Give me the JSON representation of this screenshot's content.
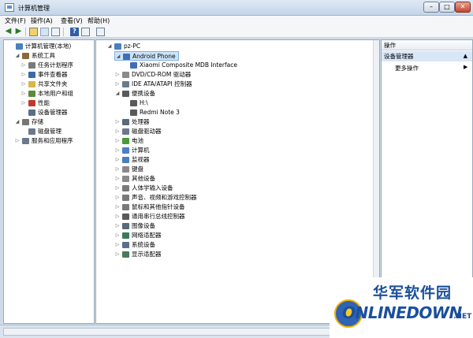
{
  "window": {
    "title": "计算机管理",
    "min": "–",
    "max": "□",
    "close": "✕"
  },
  "menu": [
    "文件(F)",
    "操作(A)",
    "查看(V)",
    "帮助(H)"
  ],
  "toolbar": {
    "help_label": "?"
  },
  "left_tree": [
    {
      "label": "计算机管理(本地)",
      "level": 0,
      "exp": "",
      "icon": "computer-icon",
      "color": "#4a7fc1"
    },
    {
      "label": "系统工具",
      "level": 1,
      "exp": "◢",
      "icon": "tools-icon",
      "color": "#8a6a3a"
    },
    {
      "label": "任务计划程序",
      "level": 2,
      "exp": "▷",
      "icon": "clock-icon",
      "color": "#7a7a7a"
    },
    {
      "label": "事件查看器",
      "level": 2,
      "exp": "▷",
      "icon": "event-viewer-icon",
      "color": "#3a6aa8"
    },
    {
      "label": "共享文件夹",
      "level": 2,
      "exp": "▷",
      "icon": "shared-folder-icon",
      "color": "#d7b64a"
    },
    {
      "label": "本地用户和组",
      "level": 2,
      "exp": "▷",
      "icon": "users-icon",
      "color": "#5f8a3a"
    },
    {
      "label": "性能",
      "level": 2,
      "exp": "▷",
      "icon": "performance-icon",
      "color": "#c0392b"
    },
    {
      "label": "设备管理器",
      "level": 2,
      "exp": "",
      "icon": "device-manager-icon",
      "color": "#5a6f8a"
    },
    {
      "label": "存储",
      "level": 1,
      "exp": "◢",
      "icon": "storage-icon",
      "color": "#777777"
    },
    {
      "label": "磁盘管理",
      "level": 2,
      "exp": "",
      "icon": "disk-icon",
      "color": "#6a7a8a"
    },
    {
      "label": "服务和应用程序",
      "level": 1,
      "exp": "▷",
      "icon": "services-icon",
      "color": "#6a7a8a"
    }
  ],
  "device_tree": [
    {
      "label": "pz-PC",
      "level": 0,
      "exp": "◢",
      "icon": "computer-icon",
      "color": "#4a7fc1"
    },
    {
      "label": "Android Phone",
      "level": 1,
      "exp": "◢",
      "icon": "phone-icon",
      "color": "#3e6fb5",
      "selected": true
    },
    {
      "label": "Xiaomi Composite MDB Interface",
      "level": 2,
      "exp": "",
      "icon": "phone-icon",
      "color": "#3e6fb5"
    },
    {
      "label": "DVD/CD-ROM 驱动器",
      "level": 1,
      "exp": "▷",
      "icon": "dvd-icon",
      "color": "#8a8a8a"
    },
    {
      "label": "IDE ATA/ATAPI 控制器",
      "level": 1,
      "exp": "▷",
      "icon": "ide-controller-icon",
      "color": "#6a7a8a"
    },
    {
      "label": "便携设备",
      "level": 1,
      "exp": "◢",
      "icon": "portable-device-icon",
      "color": "#5a5a5a"
    },
    {
      "label": "H:\\",
      "level": 2,
      "exp": "",
      "icon": "portable-device-icon",
      "color": "#5a5a5a"
    },
    {
      "label": "Redmi Note 3",
      "level": 2,
      "exp": "",
      "icon": "portable-device-icon",
      "color": "#5a5a5a"
    },
    {
      "label": "处理器",
      "level": 1,
      "exp": "▷",
      "icon": "processor-icon",
      "color": "#5a6a7a"
    },
    {
      "label": "磁盘驱动器",
      "level": 1,
      "exp": "▷",
      "icon": "disk-icon",
      "color": "#6a7a8a"
    },
    {
      "label": "电池",
      "level": 1,
      "exp": "▷",
      "icon": "battery-icon",
      "color": "#4a9a3a"
    },
    {
      "label": "计算机",
      "level": 1,
      "exp": "▷",
      "icon": "computer-icon",
      "color": "#4a7fc1"
    },
    {
      "label": "监视器",
      "level": 1,
      "exp": "▷",
      "icon": "monitor-icon",
      "color": "#4a7fc1"
    },
    {
      "label": "键盘",
      "level": 1,
      "exp": "▷",
      "icon": "keyboard-icon",
      "color": "#8a8a8a"
    },
    {
      "label": "其他设备",
      "level": 1,
      "exp": "▷",
      "icon": "other-device-icon",
      "color": "#8a8a8a"
    },
    {
      "label": "人体学输入设备",
      "level": 1,
      "exp": "▷",
      "icon": "hid-icon",
      "color": "#7a7a7a"
    },
    {
      "label": "声音、视频和游戏控制器",
      "level": 1,
      "exp": "▷",
      "icon": "sound-icon",
      "color": "#7a7a7a"
    },
    {
      "label": "鼠标和其他指针设备",
      "level": 1,
      "exp": "▷",
      "icon": "mouse-icon",
      "color": "#7a7a7a"
    },
    {
      "label": "通用串行总线控制器",
      "level": 1,
      "exp": "▷",
      "icon": "usb-icon",
      "color": "#5a5a5a"
    },
    {
      "label": "图像设备",
      "level": 1,
      "exp": "▷",
      "icon": "camera-icon",
      "color": "#5a6a7a"
    },
    {
      "label": "网络适配器",
      "level": 1,
      "exp": "▷",
      "icon": "network-icon",
      "color": "#3a7a5a"
    },
    {
      "label": "系统设备",
      "level": 1,
      "exp": "▷",
      "icon": "system-device-icon",
      "color": "#5a6f8a"
    },
    {
      "label": "显示适配器",
      "level": 1,
      "exp": "▷",
      "icon": "display-adapter-icon",
      "color": "#4a7a5a"
    }
  ],
  "actions": {
    "header": "操作",
    "section": "设备管理器",
    "section_arrow": "▲",
    "more": "更多操作",
    "more_arrow": "▶"
  },
  "watermark": {
    "cn": "华军软件园",
    "en": "ONLINEDOWN",
    "net": ".NET"
  }
}
